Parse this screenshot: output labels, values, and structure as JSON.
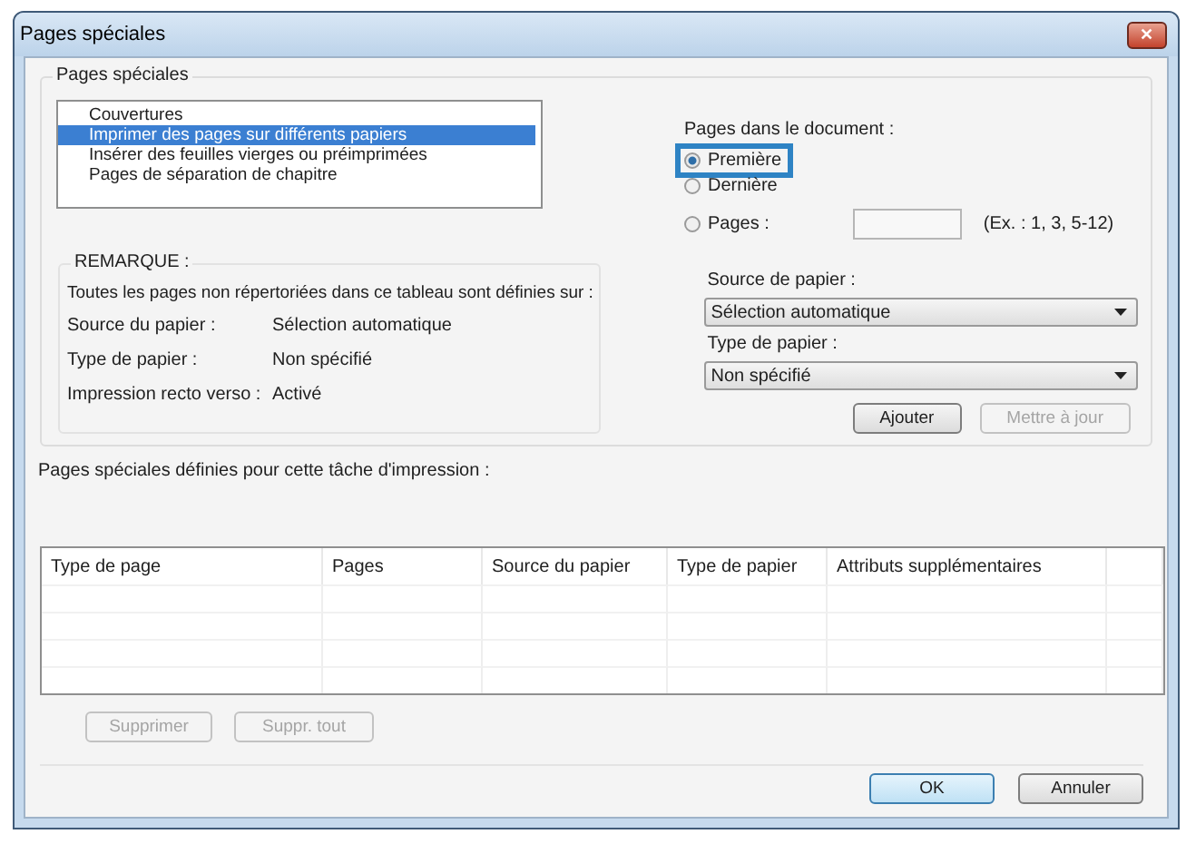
{
  "window": {
    "title": "Pages spéciales",
    "close": "✕"
  },
  "group": {
    "title": "Pages spéciales",
    "items": [
      {
        "label": "Couvertures",
        "selected": false
      },
      {
        "label": "Imprimer des pages sur différents papiers",
        "selected": true
      },
      {
        "label": "Insérer des feuilles vierges ou préimprimées",
        "selected": false
      },
      {
        "label": "Pages de séparation de chapitre",
        "selected": false
      }
    ],
    "pages_label": "Pages dans le document :",
    "radios": [
      {
        "label": "Première",
        "selected": true,
        "highlighted": true
      },
      {
        "label": "Dernière",
        "selected": false,
        "highlighted": false
      },
      {
        "label": "Pages :",
        "selected": false,
        "highlighted": false,
        "field": true
      }
    ],
    "pages_hint": "(Ex. : 1, 3, 5-12)",
    "note": {
      "title": "REMARQUE :",
      "text": "Toutes les pages non répertoriées dans ce tableau sont définies sur :",
      "rows": [
        {
          "label": "Source du papier :",
          "value": "Sélection automatique"
        },
        {
          "label": "Type de papier :",
          "value": "Non spécifié"
        },
        {
          "label": "Impression recto verso :",
          "value": "Activé"
        }
      ]
    },
    "source_label": "Source de papier :",
    "source_value": "Sélection automatique",
    "type_label": "Type de papier :",
    "type_value": "Non spécifié",
    "buttons": [
      {
        "label": "Ajouter",
        "disabled": false
      },
      {
        "label": "Mettre à jour",
        "disabled": true
      }
    ]
  },
  "defined_label": "Pages spéciales définies pour cette tâche d'impression :",
  "table": {
    "columns": [
      "Type de page",
      "Pages",
      "Source du papier",
      "Type de papier",
      "Attributs supplémentaires"
    ]
  },
  "table_buttons": [
    {
      "label": "Supprimer",
      "disabled": true
    },
    {
      "label": "Suppr. tout",
      "disabled": true
    }
  ],
  "dialog_buttons": [
    {
      "label": "OK",
      "default": true
    },
    {
      "label": "Annuler",
      "default": false
    }
  ]
}
